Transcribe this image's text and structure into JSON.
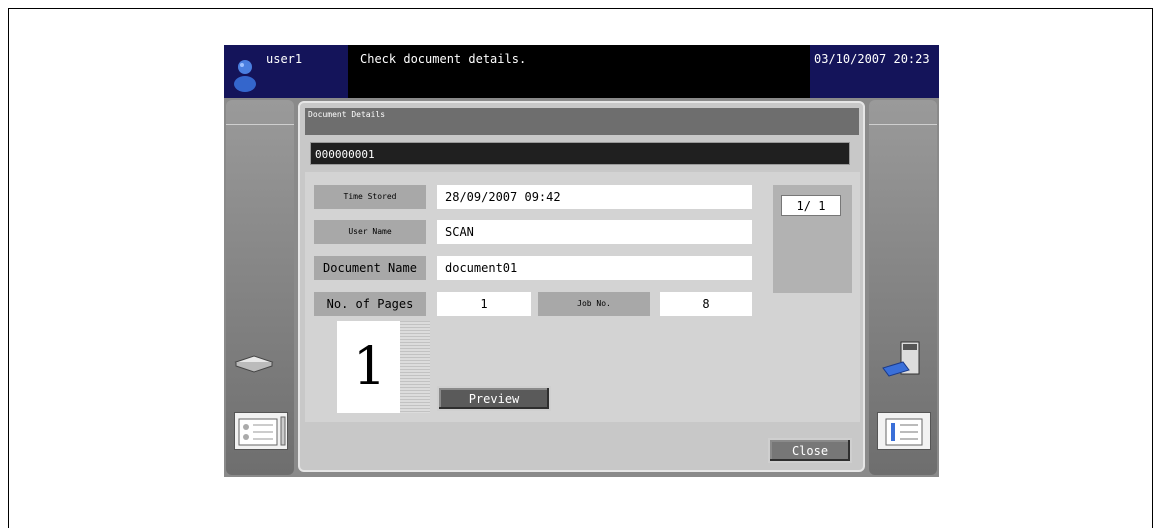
{
  "header": {
    "user_name": "user1",
    "message": "Check document details.",
    "datetime": "03/10/2007 20:23"
  },
  "dialog": {
    "title": "Document Details",
    "document_number": "000000001",
    "fields": {
      "time_stored_label": "Time Stored",
      "time_stored_value": "28/09/2007 09:42",
      "user_name_label": "User Name",
      "user_name_value": "SCAN",
      "document_name_label": "Document Name",
      "document_name_value": "document01",
      "pages_label": "No. of Pages",
      "pages_value": "1",
      "job_label": "Job No.",
      "job_value": "8"
    },
    "page_counter": "1/ 1",
    "thumbnail_page": "1",
    "preview_label": "Preview",
    "close_label": "Close"
  },
  "icons": {
    "user": "user-icon",
    "scanner": "scanner-icon",
    "job_list": "job-list-icon",
    "copier": "copier-icon",
    "settings_list": "settings-list-icon"
  }
}
